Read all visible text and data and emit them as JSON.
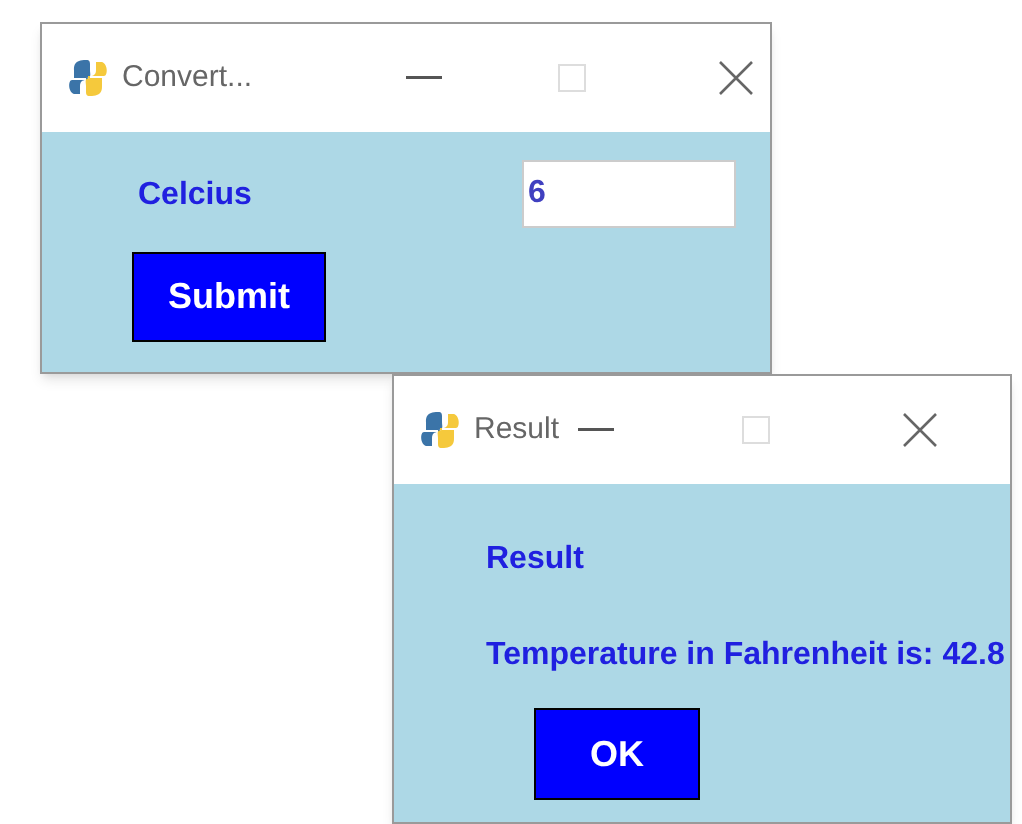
{
  "windows": [
    {
      "title": "Convert...",
      "fields": [
        {
          "label": "Celcius",
          "value": "6"
        }
      ],
      "buttons": [
        "Submit"
      ]
    },
    {
      "title": "Result",
      "heading": "Result",
      "message": "Temperature in Fahrenheit is: 42.8",
      "buttons": [
        "OK"
      ]
    }
  ]
}
